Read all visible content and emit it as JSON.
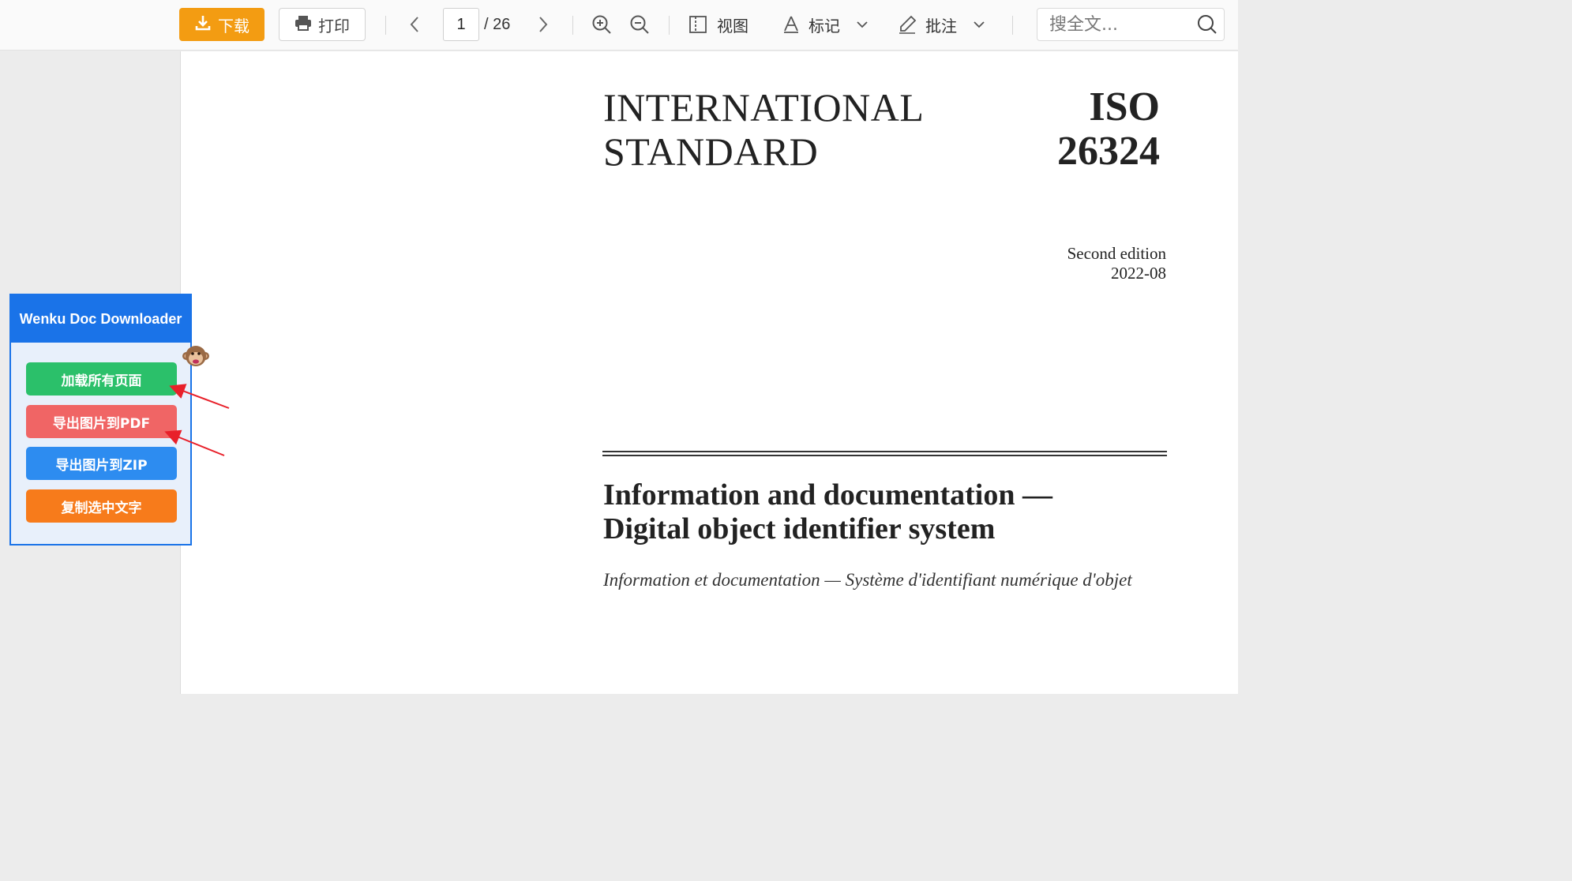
{
  "toolbar": {
    "download_label": "下载",
    "print_label": "打印",
    "current_page": "1",
    "total_pages": "/ 26",
    "view_label": "视图",
    "mark_label": "标记",
    "annotate_label": "批注",
    "search_placeholder": "搜全文..."
  },
  "document": {
    "title_line1": "INTERNATIONAL",
    "title_line2": "STANDARD",
    "iso_label": "ISO",
    "iso_number": "26324",
    "edition": "Second edition",
    "date": "2022-08",
    "main_title_line1": "Information and documentation —",
    "main_title_line2": "Digital object identifier system",
    "french_title": "Information et documentation — Système d'identifiant numérique d'objet"
  },
  "plugin": {
    "title": "Wenku Doc Downloader",
    "buttons": [
      {
        "label": "加载所有页面",
        "color": "#2bc06a"
      },
      {
        "label": "导出图片到PDF",
        "color": "#f06565"
      },
      {
        "label": "导出图片到ZIP",
        "color": "#2d8cf0"
      },
      {
        "label": "复制选中文字",
        "color": "#f77b1b"
      }
    ]
  },
  "colors": {
    "download_accent": "#f39c12",
    "plugin_accent": "#1a73e8",
    "annotation_arrow": "#e8202a"
  }
}
